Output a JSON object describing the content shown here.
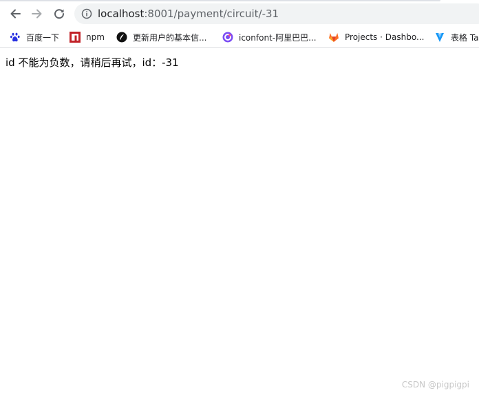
{
  "browser": {
    "url_host": "localhost",
    "url_path": ":8001/payment/circuit/-31",
    "icons": {
      "back": "back-arrow-icon",
      "forward": "forward-arrow-icon",
      "reload": "reload-icon",
      "site_info": "info-icon"
    },
    "colors": {
      "toolbar_bg": "#ffffff",
      "omnibox_bg": "#f1f3f4",
      "text": "#202124",
      "muted": "#5f6368"
    }
  },
  "bookmarks": [
    {
      "label": "百度一下",
      "icon": "baidu-paw-icon",
      "color": "#2932e1"
    },
    {
      "label": "npm",
      "icon": "npm-icon",
      "color": "#c12127"
    },
    {
      "label": "更新用户的基本信...",
      "icon": "feather-icon",
      "color": "#111111"
    },
    {
      "label": "iconfont-阿里巴巴...",
      "icon": "iconfont-icon",
      "color": "#7a4cf4"
    },
    {
      "label": "Projects · Dashbo...",
      "icon": "gitlab-fox-icon",
      "color": "#fc6d26"
    },
    {
      "label": "表格 Ta",
      "icon": "vuetify-icon",
      "color": "#1697f6"
    }
  ],
  "page": {
    "message": "id 不能为负数，请稍后再试，id：-31"
  },
  "watermark": "CSDN @pigpigpi"
}
